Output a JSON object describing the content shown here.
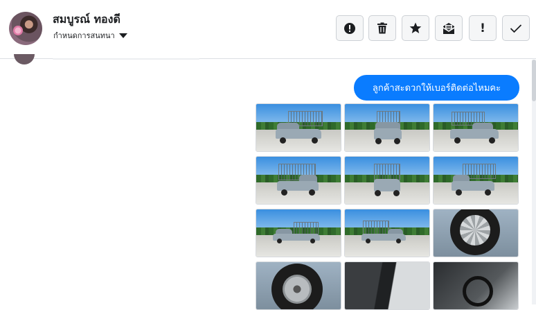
{
  "header": {
    "contact_name": "สมบูรณ์ ทองดี",
    "conversation_settings": "กำหนดการสนทนา",
    "actions": [
      {
        "name": "report-button",
        "icon": "alert-circle-icon",
        "label": ""
      },
      {
        "name": "delete-button",
        "icon": "trash-icon",
        "label": ""
      },
      {
        "name": "star-button",
        "icon": "star-icon",
        "label": ""
      },
      {
        "name": "mark-unread-button",
        "icon": "open-mail-icon",
        "label": ""
      },
      {
        "name": "important-button",
        "icon": "exclamation-icon",
        "label": "!"
      },
      {
        "name": "done-button",
        "icon": "checkmark-icon",
        "label": ""
      }
    ]
  },
  "thread": {
    "message": "ลูกค้าสะดวกให้เบอร์ติดต่อไหมคะ",
    "attachments": [
      {
        "subject": "pickup truck with cage, front-left view"
      },
      {
        "subject": "pickup truck with cage, front view"
      },
      {
        "subject": "pickup truck with cage, front-right view"
      },
      {
        "subject": "pickup truck with cage, rear-left view"
      },
      {
        "subject": "pickup truck with cage, rear view"
      },
      {
        "subject": "pickup truck with cage, rear-right view"
      },
      {
        "subject": "pickup truck side view"
      },
      {
        "subject": "pickup truck side view"
      },
      {
        "subject": "alloy wheel close-up"
      },
      {
        "subject": "steel wheel close-up"
      },
      {
        "subject": "door interior"
      },
      {
        "subject": "steering wheel and dashboard"
      }
    ]
  },
  "colors": {
    "bubble": "#0a7cff",
    "button_bg": "#f5f6f7",
    "border": "#ccd0d5",
    "text": "#1c1e21"
  }
}
